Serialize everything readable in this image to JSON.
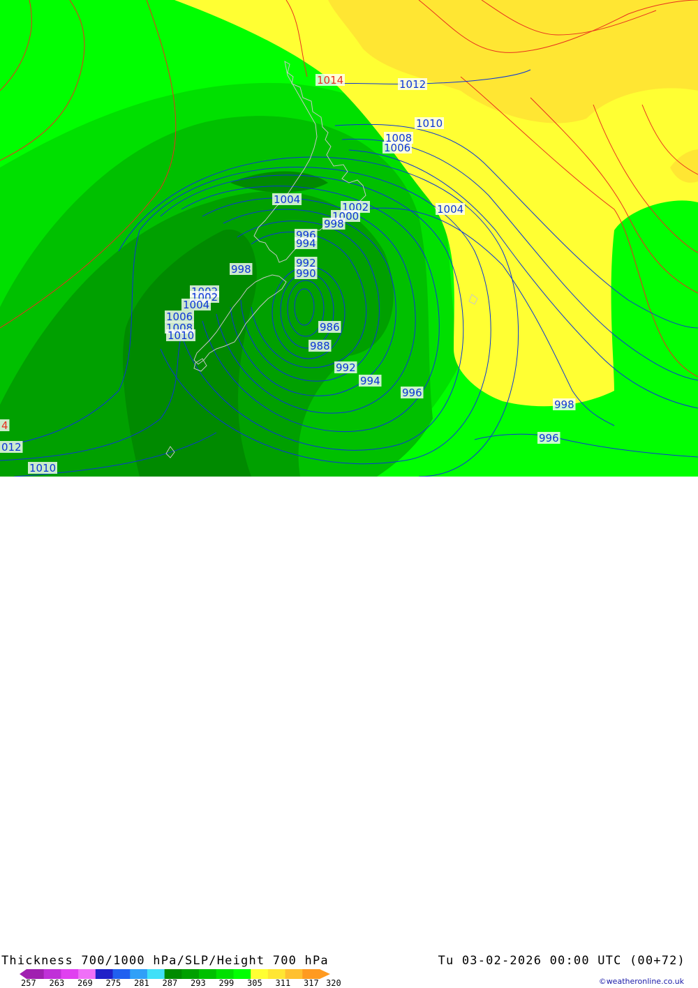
{
  "colors": {
    "lightest_green": "#00ff00",
    "light_green": "#00e000",
    "mid_green": "#00c000",
    "dark_green": "#00a000",
    "darkest_green": "#008a00",
    "light_yellow": "#ffff33",
    "yellow": "#ffe633",
    "slp_isobar": "#0b36d6",
    "height_contour": "#e8301e",
    "coastline": "#c8c8c8"
  },
  "header": {
    "title": "Thickness 700/1000 hPa/SLP/Height 700 hPa",
    "valid_time": "Tu 03-02-2026 00:00 UTC (00+72)"
  },
  "legend": {
    "ticks": [
      "257",
      "263",
      "269",
      "275",
      "281",
      "287",
      "293",
      "299",
      "305",
      "311",
      "317",
      "320"
    ],
    "swatches": [
      "#a020b0",
      "#c030d8",
      "#e040f0",
      "#f070f8",
      "#2020c8",
      "#2060f0",
      "#30a0f8",
      "#40e0f8",
      "#008a00",
      "#00a000",
      "#00c000",
      "#00e000",
      "#00ff00",
      "#ffff33",
      "#ffe633",
      "#ffc030",
      "#ff9a20",
      "#ff9a20"
    ]
  },
  "credit": "©weatheronline.co.uk",
  "isobar_labels": [
    {
      "text": "1014",
      "kind": "height"
    },
    {
      "text": "1012",
      "kind": "slp"
    },
    {
      "text": "1010",
      "kind": "slp"
    },
    {
      "text": "1008",
      "kind": "slp"
    },
    {
      "text": "1006",
      "kind": "slp"
    },
    {
      "text": "1004",
      "kind": "slp"
    },
    {
      "text": "1004",
      "kind": "slp"
    },
    {
      "text": "1002",
      "kind": "slp"
    },
    {
      "text": "1000",
      "kind": "slp"
    },
    {
      "text": "998",
      "kind": "slp"
    },
    {
      "text": "996",
      "kind": "slp"
    },
    {
      "text": "994",
      "kind": "slp"
    },
    {
      "text": "998",
      "kind": "slp"
    },
    {
      "text": "992",
      "kind": "slp"
    },
    {
      "text": "990",
      "kind": "slp"
    },
    {
      "text": "1002",
      "kind": "slp"
    },
    {
      "text": "1002",
      "kind": "slp"
    },
    {
      "text": "1004",
      "kind": "slp"
    },
    {
      "text": "1006",
      "kind": "slp"
    },
    {
      "text": "1008",
      "kind": "slp"
    },
    {
      "text": "1010",
      "kind": "slp"
    },
    {
      "text": "986",
      "kind": "slp"
    },
    {
      "text": "988",
      "kind": "slp"
    },
    {
      "text": "992",
      "kind": "slp"
    },
    {
      "text": "994",
      "kind": "slp"
    },
    {
      "text": "996",
      "kind": "slp"
    },
    {
      "text": "998",
      "kind": "slp"
    },
    {
      "text": "996",
      "kind": "slp"
    },
    {
      "text": "4",
      "kind": "height"
    },
    {
      "text": "012",
      "kind": "slp"
    },
    {
      "text": "1010",
      "kind": "slp"
    }
  ]
}
